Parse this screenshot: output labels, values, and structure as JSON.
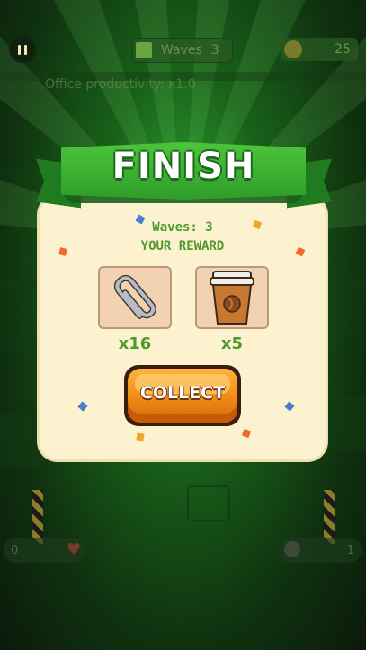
{
  "hud": {
    "waves_label": "Waves",
    "waves_value": "3",
    "coins": "25",
    "task_text": "Office productivity: x1.0",
    "left_counter": "0",
    "right_counter": "1"
  },
  "finish_panel": {
    "title": "FINISH",
    "waves_text": "Waves: 3",
    "reward_label": "YOUR REWARD",
    "rewards": [
      {
        "icon": "paperclip-icon",
        "count": "x16"
      },
      {
        "icon": "coffee-cup-icon",
        "count": "x5"
      }
    ],
    "collect_label": "COLLECT"
  },
  "colors": {
    "ribbon": "#3aae2e",
    "panel": "#fdf2cf",
    "accent_text": "#4e9a2e",
    "button": "#f08a14"
  }
}
